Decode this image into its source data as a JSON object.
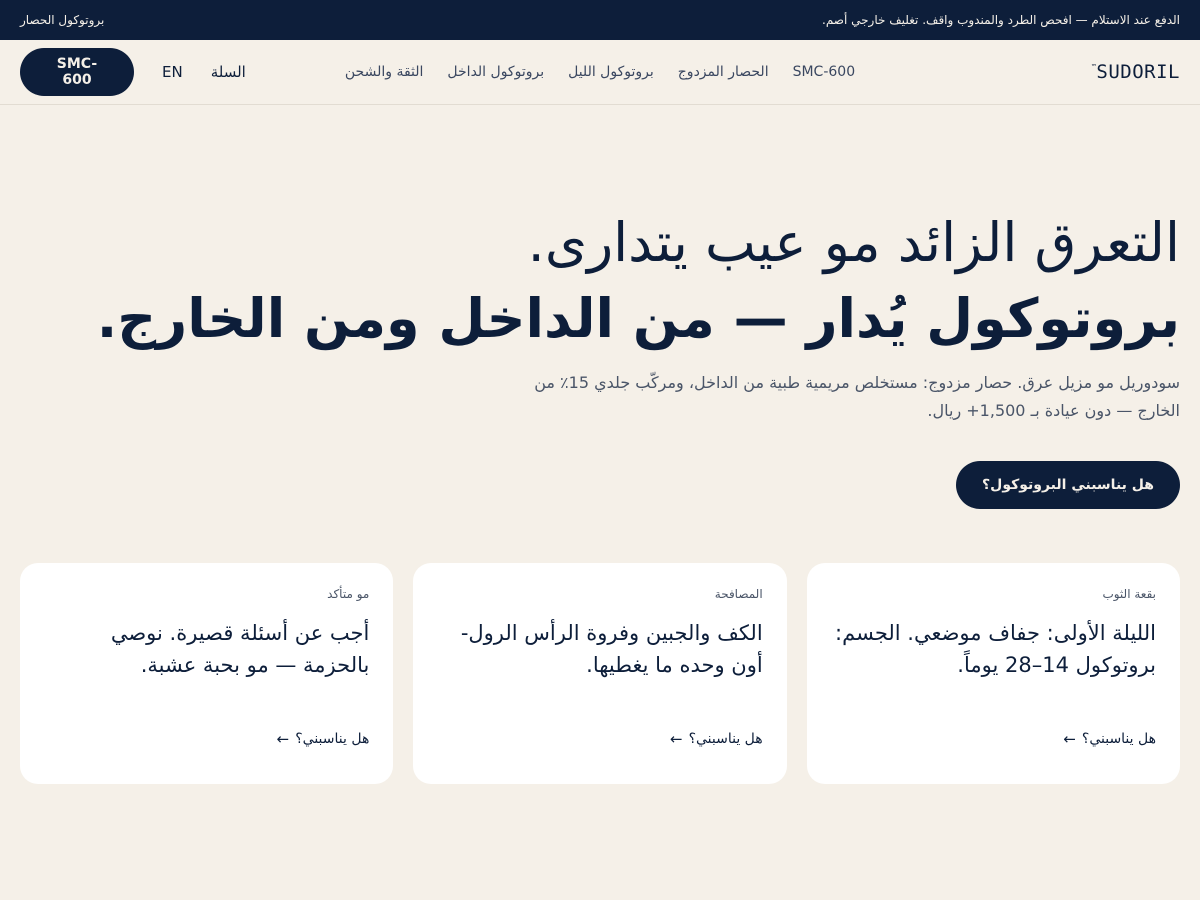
{
  "topbar": {
    "message": "الدفع عند الاستلام — افحص الطرد والمندوب واقف. تغليف خارجي أصم.",
    "protocol_link": "بروتوكول الحصار"
  },
  "navbar": {
    "logo": "SUDORIL",
    "logo_mark": "™",
    "links": [
      "SMC-600",
      "الحصار المزدوج",
      "بروتوكول الليل",
      "بروتوكول الداخل",
      "الثقة والشحن"
    ],
    "lang": "EN",
    "cart": "السلة",
    "model_button": "SMC-600"
  },
  "hero": {
    "headline_1": "التعرق الزائد مو عيب يتدارى.",
    "headline_2": "بروتوكول يُدار — من الداخل ومن الخارج.",
    "subtext": "سودوريل مو مزيل عرق. حصار مزدوج: مستخلص مريمية طبية من الداخل، ومركّب جلدي 15٪ من الخارج — دون عيادة بـ 1,500+ ريال.",
    "cta": "هل يناسبني البروتوكول؟"
  },
  "cards": [
    {
      "tag": "بقعة الثوب",
      "title": "الليلة الأولى: جفاف موضعي. الجسم: بروتوكول 14–28 يوماً.",
      "link": "هل يناسبني؟",
      "arrow_icon": "arrow-left-icon"
    },
    {
      "tag": "المصافحة",
      "title": "الكف والجبين وفروة الرأس الرول-أون وحده ما يغطيها.",
      "link": "هل يناسبني؟",
      "arrow_icon": "arrow-left-icon"
    },
    {
      "tag": "مو متأكد",
      "title": "أجب عن أسئلة قصيرة. نوصي بالحزمة — مو بحبة عشبة.",
      "link": "هل يناسبني؟",
      "arrow_icon": "arrow-left-icon"
    }
  ],
  "colors": {
    "background": "#f5f0e8",
    "navy": "#0d1e3a",
    "card": "#ffffff"
  }
}
